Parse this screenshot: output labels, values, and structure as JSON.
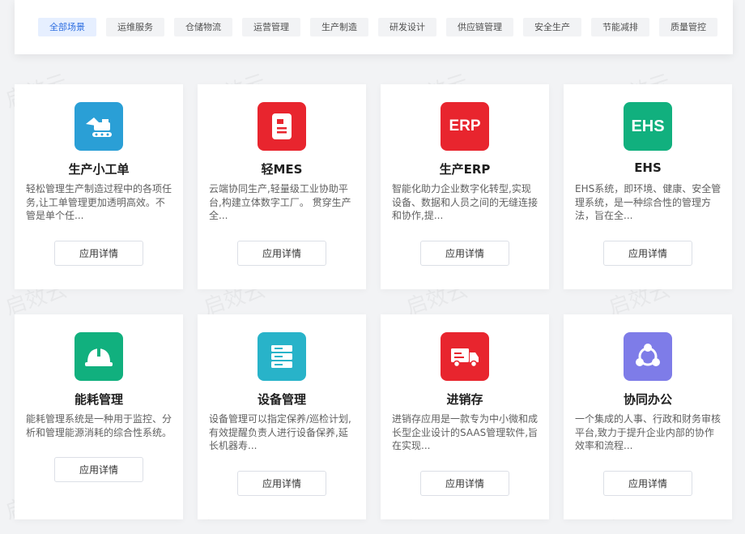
{
  "filters": [
    {
      "label": "全部场景",
      "active": true
    },
    {
      "label": "运维服务",
      "active": false
    },
    {
      "label": "仓储物流",
      "active": false
    },
    {
      "label": "运营管理",
      "active": false
    },
    {
      "label": "生产制造",
      "active": false
    },
    {
      "label": "研发设计",
      "active": false
    },
    {
      "label": "供应链管理",
      "active": false
    },
    {
      "label": "安全生产",
      "active": false
    },
    {
      "label": "节能减排",
      "active": false
    },
    {
      "label": "质量管控",
      "active": false
    }
  ],
  "watermark": "启效云",
  "apps": [
    {
      "name": "生产小工单",
      "desc": "轻松管理生产制造过程中的各项任务,让工单管理更加透明高效。不管是单个任...",
      "button": "应用详情",
      "icon": "excavator-icon",
      "color": "#2a9fd6"
    },
    {
      "name": "轻MES",
      "desc": "云端协同生产,轻量级工业协助平台,构建立体数字工厂。 贯穿生产全...",
      "button": "应用详情",
      "icon": "document-icon",
      "color": "#e8252e"
    },
    {
      "name": "生产ERP",
      "desc": "智能化助力企业数字化转型,实现设备、数据和人员之间的无缝连接和协作,提...",
      "button": "应用详情",
      "icon": "erp-icon",
      "icon_text": "ERP",
      "color": "#e8252e"
    },
    {
      "name": "EHS",
      "desc": "EHS系统，即环境、健康、安全管理系统，是一种综合性的管理方法，旨在全...",
      "button": "应用详情",
      "icon": "ehs-icon",
      "icon_text": "EHS",
      "color": "#11b07e"
    },
    {
      "name": "能耗管理",
      "desc": "能耗管理系统是一种用于监控、分析和管理能源消耗的综合性系统。",
      "button": "应用详情",
      "icon": "hardhat-icon",
      "color": "#11b07e"
    },
    {
      "name": "设备管理",
      "desc": "设备管理可以指定保养/巡检计划,有效提醒负责人进行设备保养,延长机器寿...",
      "button": "应用详情",
      "icon": "server-icon",
      "color": "#28b3c9"
    },
    {
      "name": "进销存",
      "desc": "进销存应用是一款专为中小微和成长型企业设计的SAAS管理软件,旨在实现...",
      "button": "应用详情",
      "icon": "truck-icon",
      "color": "#e8252e"
    },
    {
      "name": "协同办公",
      "desc": "一个集成的人事、行政和财务审核平台,致力于提升企业内部的协作效率和流程...",
      "button": "应用详情",
      "icon": "share-icon",
      "color": "#7e7ce8"
    }
  ]
}
